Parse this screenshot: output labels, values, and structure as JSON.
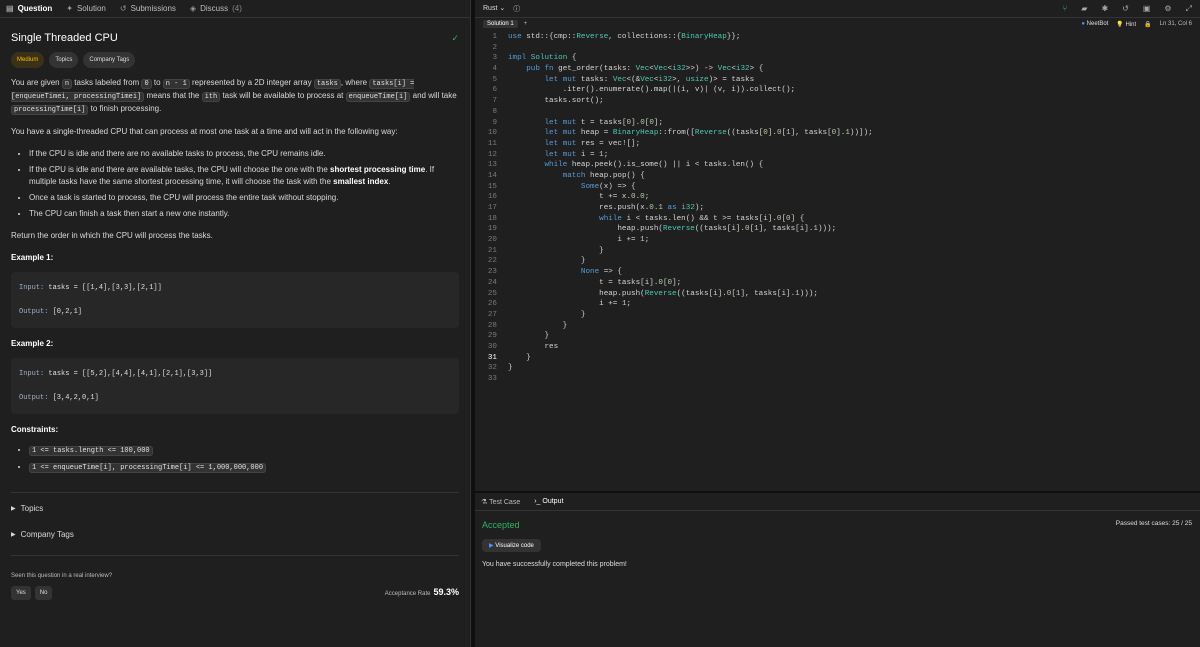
{
  "left_tabs": [
    {
      "icon": "document-icon",
      "label": "Question"
    },
    {
      "icon": "lightbulb-icon",
      "label": "Solution"
    },
    {
      "icon": "history-icon",
      "label": "Submissions"
    },
    {
      "icon": "chat-icon",
      "label": "Discuss",
      "count": "(4)"
    }
  ],
  "question": {
    "title": "Single Threaded CPU",
    "difficulty": "Medium",
    "pills": [
      "Topics",
      "Company Tags"
    ],
    "para1": [
      "You are given ",
      "n",
      " tasks labeled from ",
      "0",
      " to ",
      "n - 1",
      " represented by a 2D integer array ",
      "tasks",
      ", where ",
      "tasks[i] = [enqueueTimei, processingTimei]",
      " means that the ",
      "ith",
      " task will be available to process at ",
      "enqueueTime[i]",
      " and will take ",
      "processingTime[i]",
      " to finish processing."
    ],
    "para2": "You have a single-threaded CPU that can process at most one task at a time and will act in the following way:",
    "bullets": {
      "b1": "If the CPU is idle and there are no available tasks to process, the CPU remains idle.",
      "b2a": "If the CPU is idle and there are available tasks, the CPU will choose the one with the ",
      "b2b": "shortest processing time",
      ". If multiple": "",
      "b2c": ". If multiple tasks have the same shortest processing time, it will choose the task with the ",
      "b2d": "smallest index",
      "b2e": ".",
      "b3": "Once a task is started to process, the CPU will process the entire task without stopping.",
      "b4": "The CPU can finish a task then start a new one instantly."
    },
    "para3": "Return the order in which the CPU will process the tasks.",
    "ex1": {
      "heading": "Example 1:",
      "input_k": "Input:",
      "input_v": " tasks = [[1,4],[3,3],[2,1]]",
      "output_k": "Output:",
      "output_v": " [0,2,1]"
    },
    "ex2": {
      "heading": "Example 2:",
      "input_k": "Input:",
      "input_v": " tasks = [[5,2],[4,4],[4,1],[2,1],[3,3]]",
      "output_k": "Output:",
      "output_v": " [3,4,2,0,1]"
    },
    "constraints_heading": "Constraints:",
    "constraints": [
      "1 <= tasks.length <= 100,000",
      "1 <= enqueueTime[i], processingTime[i] <= 1,000,000,000"
    ],
    "fold_topics": "Topics",
    "fold_company": "Company Tags",
    "seen": "Seen this question in a real interview?",
    "yes": "Yes",
    "no": "No",
    "acceptance_label": "Acceptance Rate",
    "acceptance_value": "59.3%"
  },
  "editor": {
    "language": "Rust",
    "tab": "Solution 1",
    "add": "+",
    "neetbot": "NeetBot",
    "hint": "Hint",
    "cursor": "Ln 31, Col 6"
  },
  "code_lines": [
    "use std::{cmp::Reverse, collections::{BinaryHeap}};",
    "",
    "impl Solution {",
    "    pub fn get_order(tasks: Vec<Vec<i32>>) -> Vec<i32> {",
    "        let mut tasks: Vec<(&Vec<i32>, usize)> = tasks",
    "            .iter().enumerate().map(|(i, v)| (v, i)).collect();",
    "        tasks.sort();",
    "",
    "        let mut t = tasks[0].0[0];",
    "        let mut heap = BinaryHeap::from([Reverse((tasks[0].0[1], tasks[0].1))]);",
    "        let mut res = vec![];",
    "        let mut i = 1;",
    "        while heap.peek().is_some() || i < tasks.len() {",
    "            match heap.pop() {",
    "                Some(x) => {",
    "                    t += x.0.0;",
    "                    res.push(x.0.1 as i32);",
    "                    while i < tasks.len() && t >= tasks[i].0[0] {",
    "                        heap.push(Reverse((tasks[i].0[1], tasks[i].1)));",
    "                        i += 1;",
    "                    }",
    "                }",
    "                None => {",
    "                    t = tasks[i].0[0];",
    "                    heap.push(Reverse((tasks[i].0[1], tasks[i].1)));",
    "                    i += 1;",
    "                }",
    "            }",
    "        }",
    "        res",
    "    }",
    "}",
    ""
  ],
  "panel": {
    "testcase": "Test Case",
    "output": "Output",
    "status": "Accepted",
    "passed": "Passed test cases: 25 / 25",
    "visualize": "Visualize code",
    "message": "You have successfully completed this problem!"
  }
}
